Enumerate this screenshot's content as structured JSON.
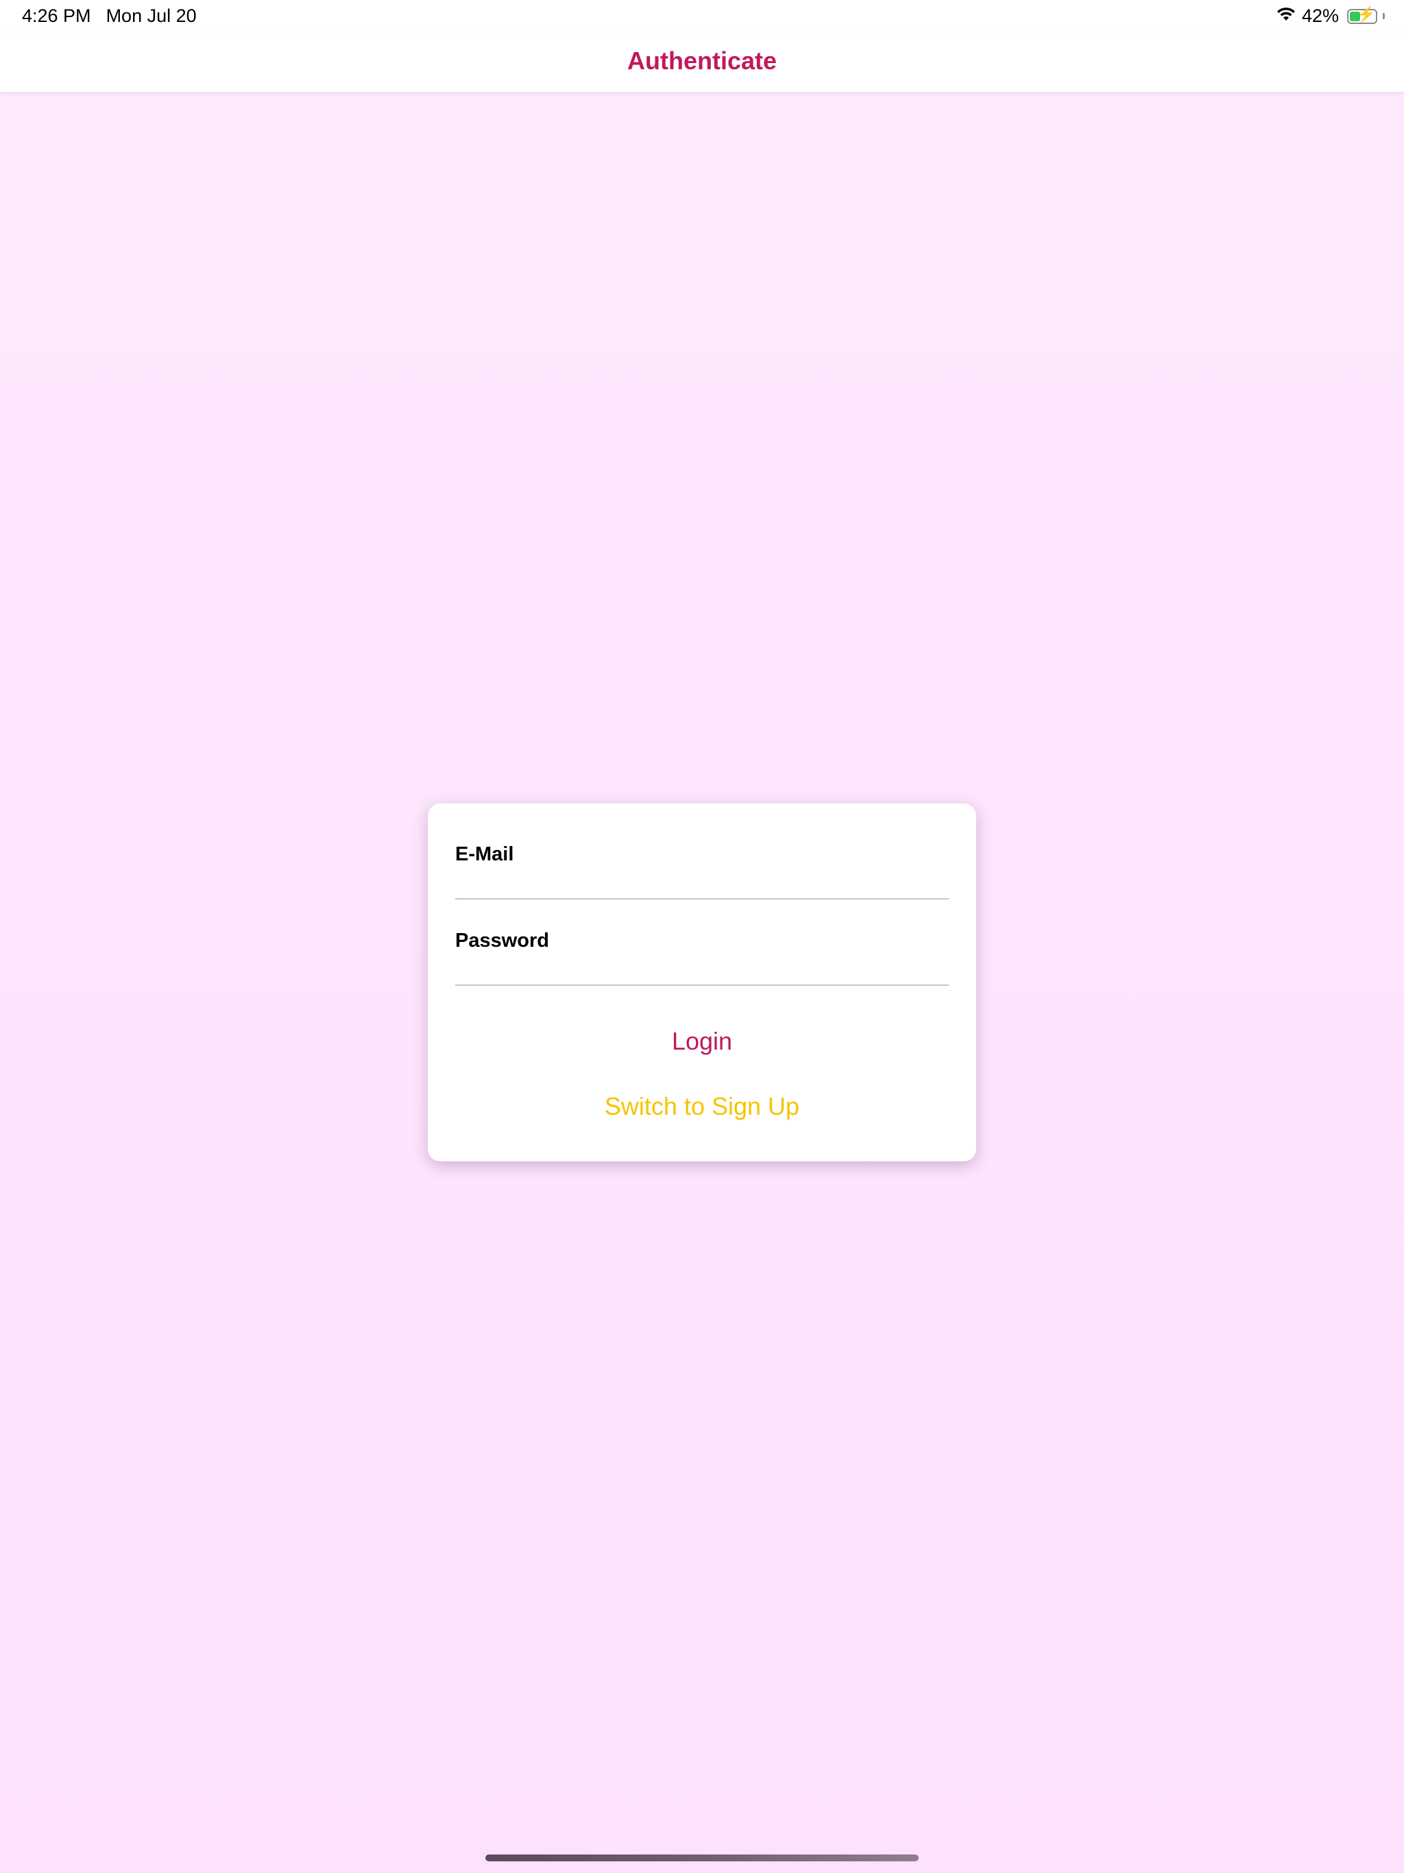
{
  "status_bar": {
    "time": "4:26 PM",
    "date": "Mon Jul 20",
    "battery_percent_label": "42%",
    "battery_level": 0.42,
    "battery_color": "#34c759",
    "icons": [
      "wifi-icon",
      "battery-icon",
      "charging-bolt-icon"
    ]
  },
  "nav": {
    "title": "Authenticate",
    "title_color": "#c2185b"
  },
  "auth_form": {
    "email_label": "E-Mail",
    "email_value": "",
    "password_label": "Password",
    "password_value": "",
    "login_label": "Login",
    "login_color": "#c2185b",
    "switch_label": "Switch to Sign Up",
    "switch_color": "#f5c300"
  },
  "colors": {
    "background": "#fee9fe",
    "card": "#ffffff"
  }
}
